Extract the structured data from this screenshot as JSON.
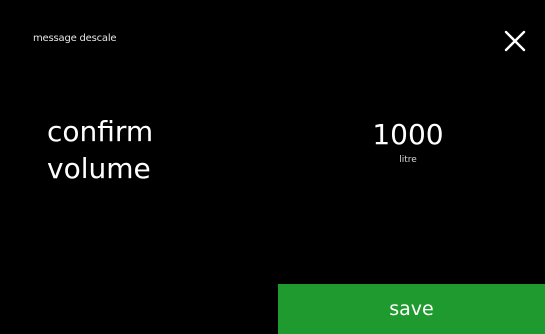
{
  "header": {
    "title": "message descale",
    "close_icon": "close-icon"
  },
  "prompt": {
    "line1": "confirm",
    "line2": "volume"
  },
  "volume": {
    "value": "1000",
    "unit": "litre"
  },
  "actions": {
    "save_label": "save"
  },
  "colors": {
    "background": "#000000",
    "text": "#ffffff",
    "save_button": "#1f9a2f"
  }
}
